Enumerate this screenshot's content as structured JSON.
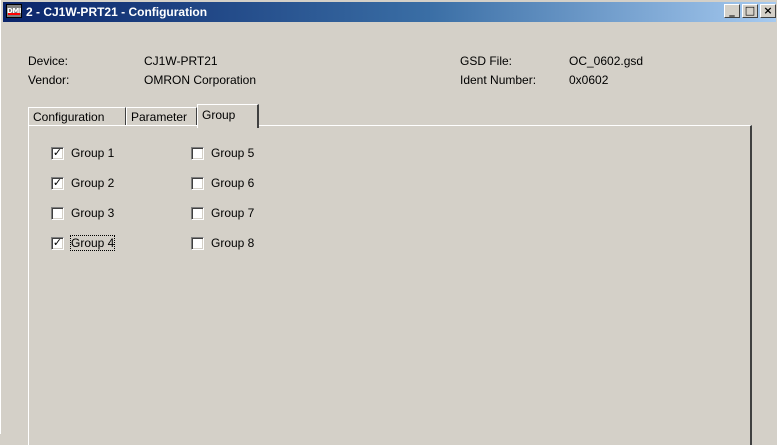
{
  "window": {
    "title": "2 - CJ1W-PRT21 - Configuration",
    "icon_text": "DMI",
    "buttons": {
      "minimize": "_",
      "maximize": "□",
      "close": "×"
    }
  },
  "info": {
    "device_label": "Device:",
    "device_value": "CJ1W-PRT21",
    "vendor_label": "Vendor:",
    "vendor_value": "OMRON Corporation",
    "gsd_label": "GSD File:",
    "gsd_value": "OC_0602.gsd",
    "ident_label": "Ident Number:",
    "ident_value": "0x0602"
  },
  "tabs": [
    {
      "label": "Configuration",
      "active": false
    },
    {
      "label": "Parameter",
      "active": false
    },
    {
      "label": "Group",
      "active": true
    }
  ],
  "groups": [
    {
      "label": "Group 1",
      "checked": true
    },
    {
      "label": "Group 2",
      "checked": true
    },
    {
      "label": "Group 3",
      "checked": false
    },
    {
      "label": "Group 4",
      "checked": true,
      "focused": true
    },
    {
      "label": "Group 5",
      "checked": false
    },
    {
      "label": "Group 6",
      "checked": false
    },
    {
      "label": "Group 7",
      "checked": false
    },
    {
      "label": "Group 8",
      "checked": false
    }
  ]
}
